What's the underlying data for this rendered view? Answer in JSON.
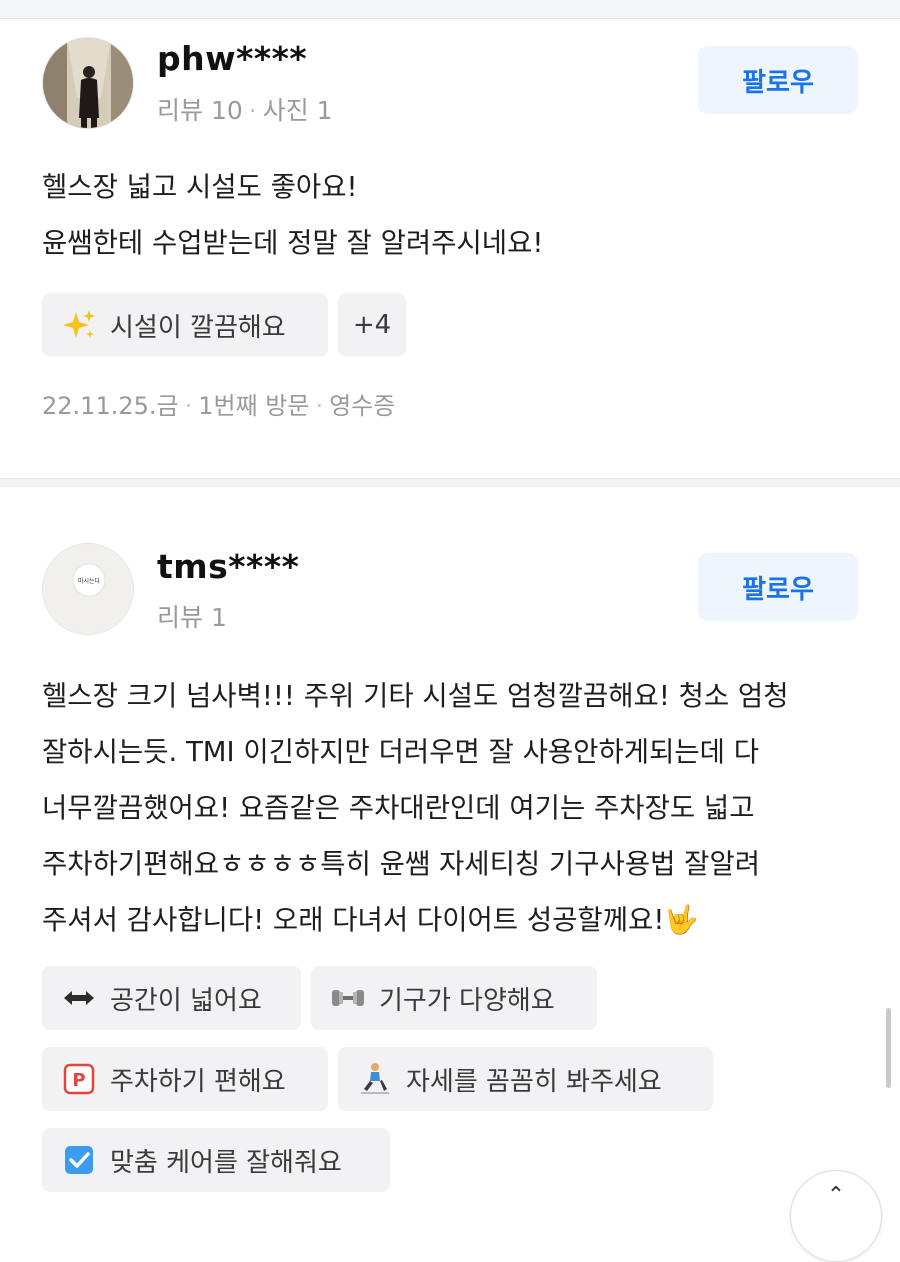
{
  "reviews": [
    {
      "username": "phw****",
      "review_count": "리뷰 10",
      "photo_count": "사진 1",
      "follow_label": "팔로우",
      "text_lines": [
        "헬스장 넓고 시설도 좋아요!",
        "윤쌤한테 수업받는데 정말 잘 알려주시네요!"
      ],
      "tags": [
        {
          "icon": "sparkles-icon",
          "label": "시설이 깔끔해요"
        },
        {
          "icon": "",
          "label": "+4"
        }
      ],
      "date": "22.11.25.금",
      "visit": "1번째 방문",
      "verification": "영수증"
    },
    {
      "username": "tms****",
      "review_count": "리뷰 1",
      "follow_label": "팔로우",
      "avatar_text": "마시는다",
      "text_lines": [
        "헬스장 크기 넘사벽!!! 주위 기타 시설도 엄청깔끔해요! 청소 엄청",
        "잘하시는듯. TMI 이긴하지만 더러우면 잘 사용안하게되는데 다",
        "너무깔끔했어요! 요즘같은 주차대란인데 여기는 주차장도 넓고",
        "주차하기편해요ㅎㅎㅎㅎ특히 윤쌤 자세티칭 기구사용법 잘알려",
        "주셔서 감사합니다! 오래 다녀서 다이어트 성공할께요!🤟"
      ],
      "tags": [
        {
          "icon": "left-right-arrow-icon",
          "label": "공간이 넓어요"
        },
        {
          "icon": "dumbbell-icon",
          "label": "기구가 다양해요"
        },
        {
          "icon": "parking-icon",
          "label": "주차하기 편해요"
        },
        {
          "icon": "person-exercising-icon",
          "label": "자세를 꼼꼼히 봐주세요"
        },
        {
          "icon": "checkbox-icon",
          "label": "맞춤 케어를 잘해줘요"
        }
      ]
    }
  ]
}
